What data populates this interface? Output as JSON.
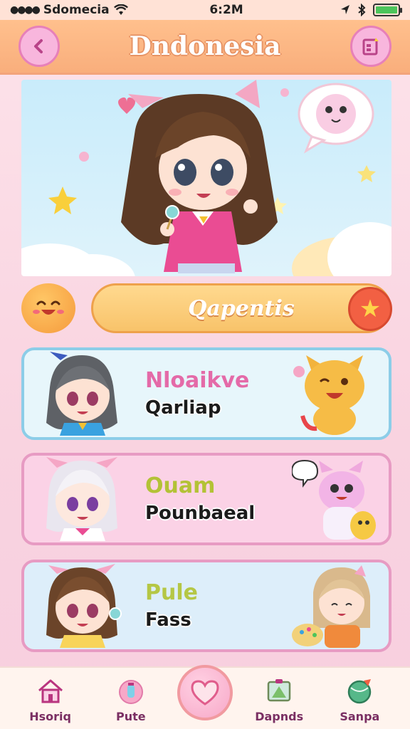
{
  "status_bar": {
    "carrier": "Sdomecia",
    "time": "6:2M",
    "battery_level": 1.0
  },
  "header": {
    "title": "Dndonesia",
    "back_icon": "chevron-left-icon",
    "right_icon": "music-note-icon"
  },
  "featured": {
    "label": "Qapentis"
  },
  "cards": [
    {
      "title": "Nloaikve",
      "subtitle": "Qarliap",
      "title_color": "#e46aa8"
    },
    {
      "title": "Ouam",
      "subtitle": "Pounbaeal",
      "title_color": "#b3c236"
    },
    {
      "title": "Pule",
      "subtitle": "Fass",
      "title_color": "#b5c745"
    }
  ],
  "bottom_nav": {
    "items": [
      {
        "label": "Hsoriq",
        "icon": "home-icon"
      },
      {
        "label": "Pute",
        "icon": "potion-icon"
      },
      {
        "label": "Dapnds",
        "icon": "photo-frame-icon"
      },
      {
        "label": "Sanpa",
        "icon": "ball-icon"
      }
    ]
  },
  "colors": {
    "header": "#f9ae7c",
    "accent_pink": "#e780b9",
    "card_blue": "#8ccde8",
    "card_pink": "#e79bc3"
  }
}
